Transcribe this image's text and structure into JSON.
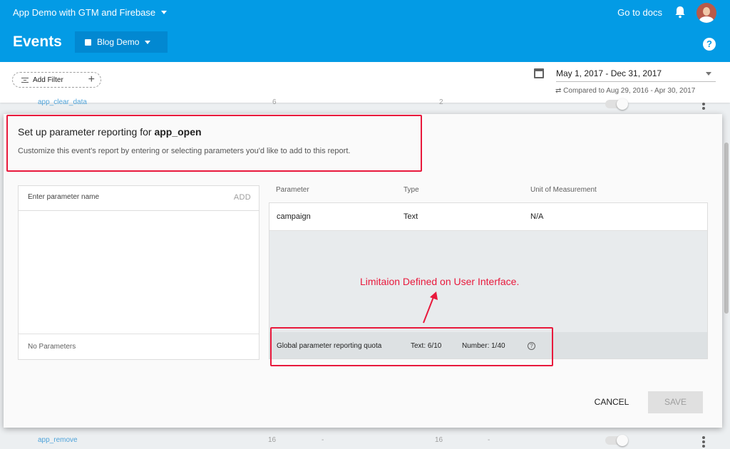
{
  "topbar": {
    "project": "App Demo with GTM and Firebase",
    "docs_link": "Go to docs",
    "title": "Events",
    "app_selector": "Blog Demo",
    "icons": [
      "caret-down-icon",
      "bell-icon",
      "avatar",
      "help-icon"
    ]
  },
  "filterbar": {
    "add_filter": "Add Filter",
    "date_range": "May 1, 2017 - Dec 31, 2017",
    "compare": "Compared to Aug 29, 2016 - Apr 30, 2017"
  },
  "background_rows": [
    {
      "name": "app_clear_data",
      "col1": "6",
      "col2": "2"
    },
    {
      "name": "app_remove",
      "col1": "16",
      "col1b": "-",
      "col2": "16",
      "col2b": "-"
    }
  ],
  "dialog": {
    "title_prefix": "Set up parameter reporting for ",
    "title_event": "app_open",
    "subtitle": "Customize this event's report by entering or selecting parameters you'd like to add to this report.",
    "param_placeholder": "Enter parameter name",
    "add_label": "ADD",
    "no_params": "No Parameters",
    "columns": [
      "Parameter",
      "Type",
      "Unit of Measurement"
    ],
    "rows": [
      {
        "parameter": "campaign",
        "type": "Text",
        "unit": "N/A"
      }
    ],
    "quota": {
      "label": "Global parameter reporting quota",
      "text": "Text: 6/10",
      "number": "Number: 1/40"
    },
    "cancel": "CANCEL",
    "save": "SAVE"
  },
  "annotation": "Limitaion Defined on User Interface.",
  "colors": {
    "primary": "#039be5",
    "primary_dark": "#0288d1",
    "annotation_red": "#e8193c"
  }
}
